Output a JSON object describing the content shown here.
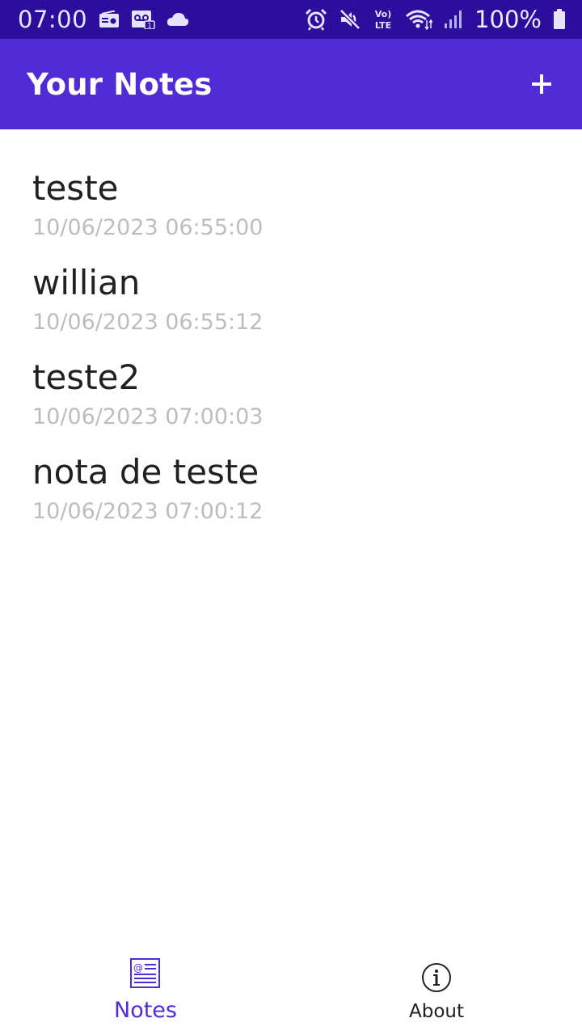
{
  "status_bar": {
    "time": "07:00",
    "left_icons": [
      "radio-icon",
      "voicemail-icon",
      "cloud-icon"
    ],
    "right_icons": [
      "alarm-icon",
      "mute-icon",
      "volte-icon",
      "wifi-icon",
      "signal-icon"
    ],
    "volte_text": "Vo) LTE",
    "battery_percent": "100%",
    "colors": {
      "background": "#2b0f9c",
      "text": "#e9e6ff"
    }
  },
  "app_bar": {
    "title": "Your Notes",
    "add_icon": "plus-icon",
    "colors": {
      "background": "#512bd4",
      "text": "#ffffff"
    }
  },
  "notes": [
    {
      "title": "teste",
      "date": "10/06/2023 06:55:00"
    },
    {
      "title": "willian",
      "date": "10/06/2023 06:55:12"
    },
    {
      "title": "teste2",
      "date": "10/06/2023 07:00:03"
    },
    {
      "title": "nota de teste",
      "date": "10/06/2023 07:00:12"
    }
  ],
  "tab_bar": {
    "tabs": [
      {
        "label": "Notes",
        "icon": "notes-icon",
        "selected": true
      },
      {
        "label": "About",
        "icon": "info-icon",
        "selected": false
      }
    ],
    "colors": {
      "selected": "#512bd4",
      "unselected": "#212121"
    }
  }
}
